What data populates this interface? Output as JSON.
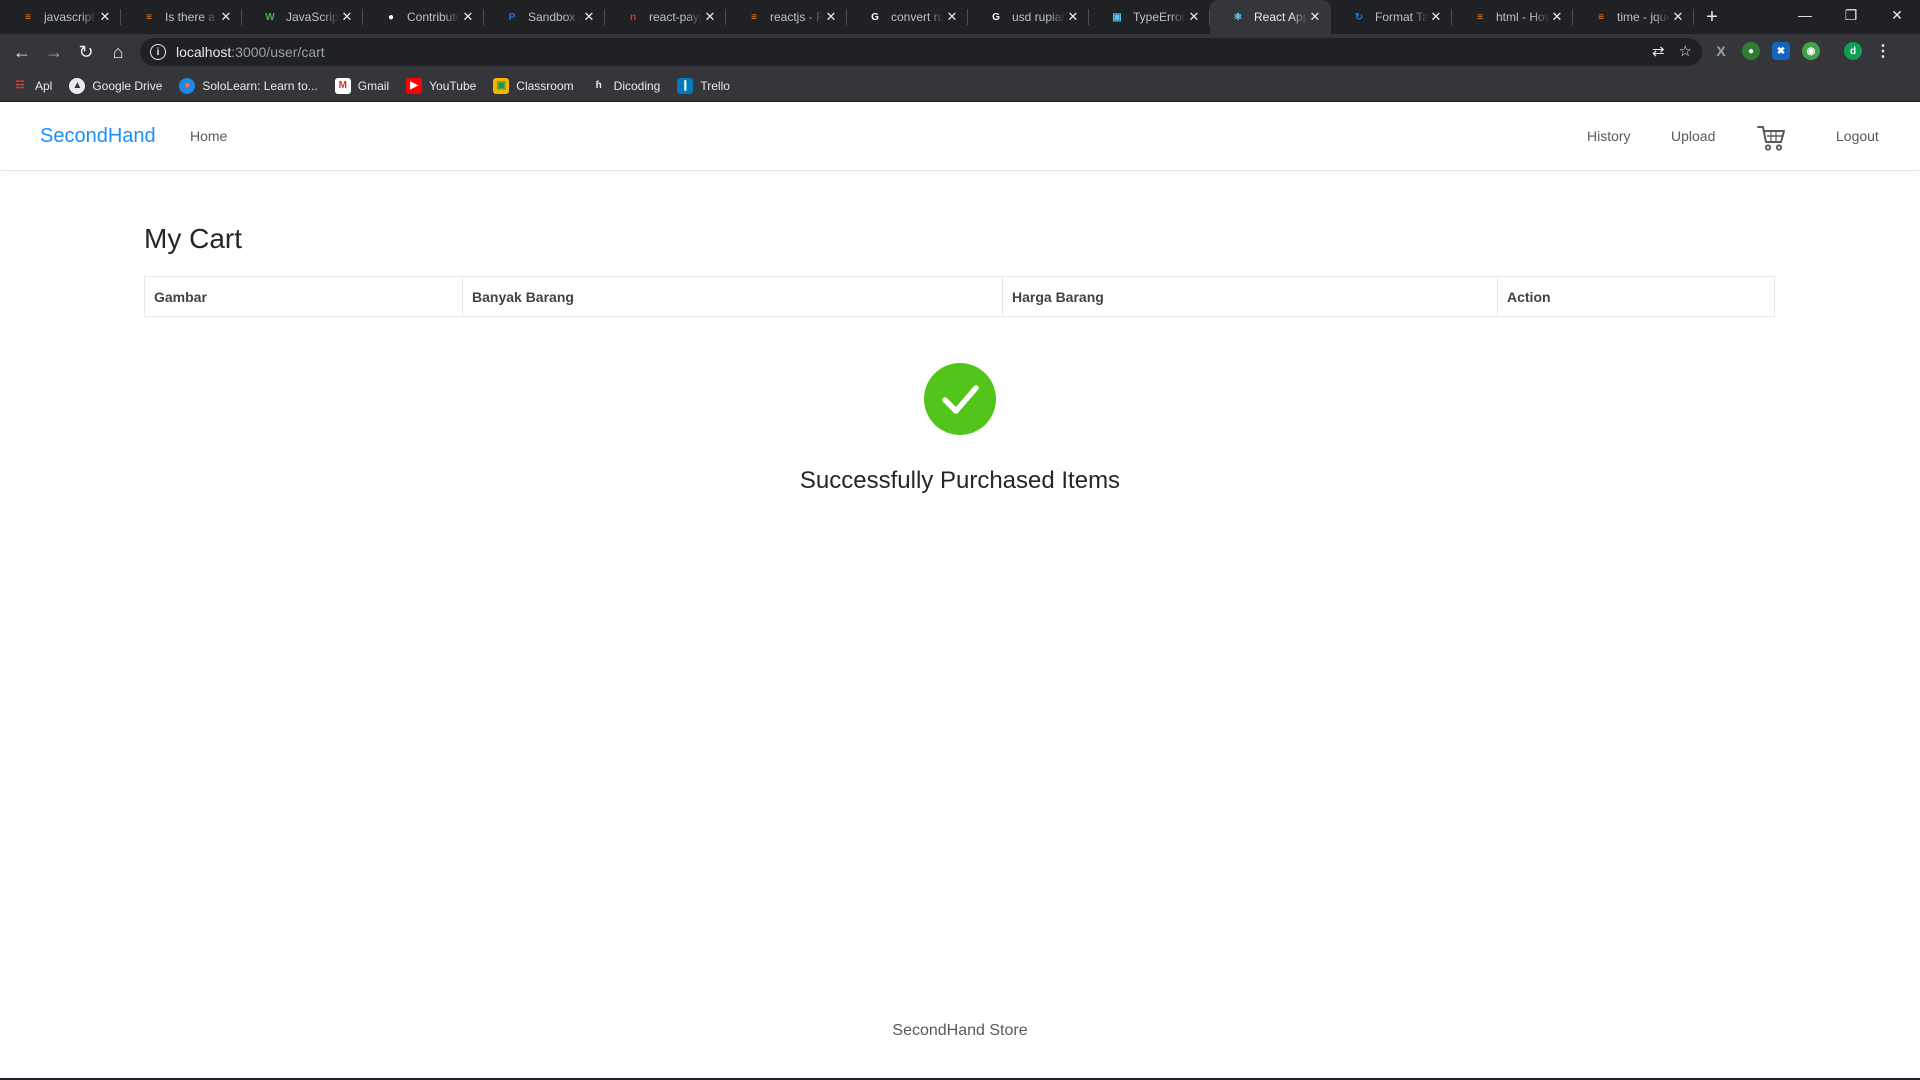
{
  "browser": {
    "tabs": [
      {
        "title": "javascript - H",
        "favicon": "stackoverflow-icon",
        "color": "#f48024"
      },
      {
        "title": "Is there a s",
        "favicon": "stackoverflow-icon",
        "color": "#f48024"
      },
      {
        "title": "JavaScript",
        "favicon": "w3schools-icon",
        "color": "#4caf50"
      },
      {
        "title": "Contributo",
        "favicon": "github-icon",
        "color": "#ffffff"
      },
      {
        "title": "Sandbox a",
        "favicon": "paypal-icon",
        "color": "#1a73e8"
      },
      {
        "title": "react-payp",
        "favicon": "npm-icon",
        "color": "#cb3837"
      },
      {
        "title": "reactjs - Re",
        "favicon": "stackoverflow-icon",
        "color": "#f48024"
      },
      {
        "title": "convert ru",
        "favicon": "google-icon",
        "color": "#ffffff"
      },
      {
        "title": "usd rupiah",
        "favicon": "google-icon",
        "color": "#ffffff"
      },
      {
        "title": "TypeError",
        "favicon": "typeerror-icon",
        "color": "#4fc3f7"
      },
      {
        "title": "React App",
        "favicon": "react-icon",
        "color": "#61dafb"
      },
      {
        "title": "Format Ta",
        "favicon": "format-icon",
        "color": "#1a73e8"
      },
      {
        "title": "html - How",
        "favicon": "stackoverflow-icon",
        "color": "#f48024"
      },
      {
        "title": "time - jque",
        "favicon": "stackoverflow-icon",
        "color": "#f48024"
      }
    ],
    "active_tab_index": 10,
    "url_host": "localhost",
    "url_path": ":3000/user/cart",
    "bookmarks": [
      {
        "label": "Apl",
        "icon": "apps-grid-icon"
      },
      {
        "label": "Google Drive",
        "icon": "google-drive-icon"
      },
      {
        "label": "SoloLearn: Learn to...",
        "icon": "sololearn-icon"
      },
      {
        "label": "Gmail",
        "icon": "gmail-icon"
      },
      {
        "label": "YouTube",
        "icon": "youtube-icon"
      },
      {
        "label": "Classroom",
        "icon": "classroom-icon"
      },
      {
        "label": "Dicoding",
        "icon": "dicoding-icon"
      },
      {
        "label": "Trello",
        "icon": "trello-icon"
      }
    ]
  },
  "navbar": {
    "brand": "SecondHand",
    "home": "Home",
    "history": "History",
    "upload": "Upload",
    "logout": "Logout",
    "cart_icon": "shopping-cart-icon"
  },
  "page": {
    "title": "My Cart",
    "columns": [
      "Gambar",
      "Banyak Barang",
      "Harga Barang",
      "Action"
    ],
    "success_message": "Successfully Purchased Items",
    "success_icon": "check-circle-icon"
  },
  "footer": {
    "text": "SecondHand Store"
  },
  "colors": {
    "brand": "#1890ff",
    "success": "#52c41a",
    "chrome_dark": "#202124",
    "chrome_toolbar": "#35363a"
  }
}
